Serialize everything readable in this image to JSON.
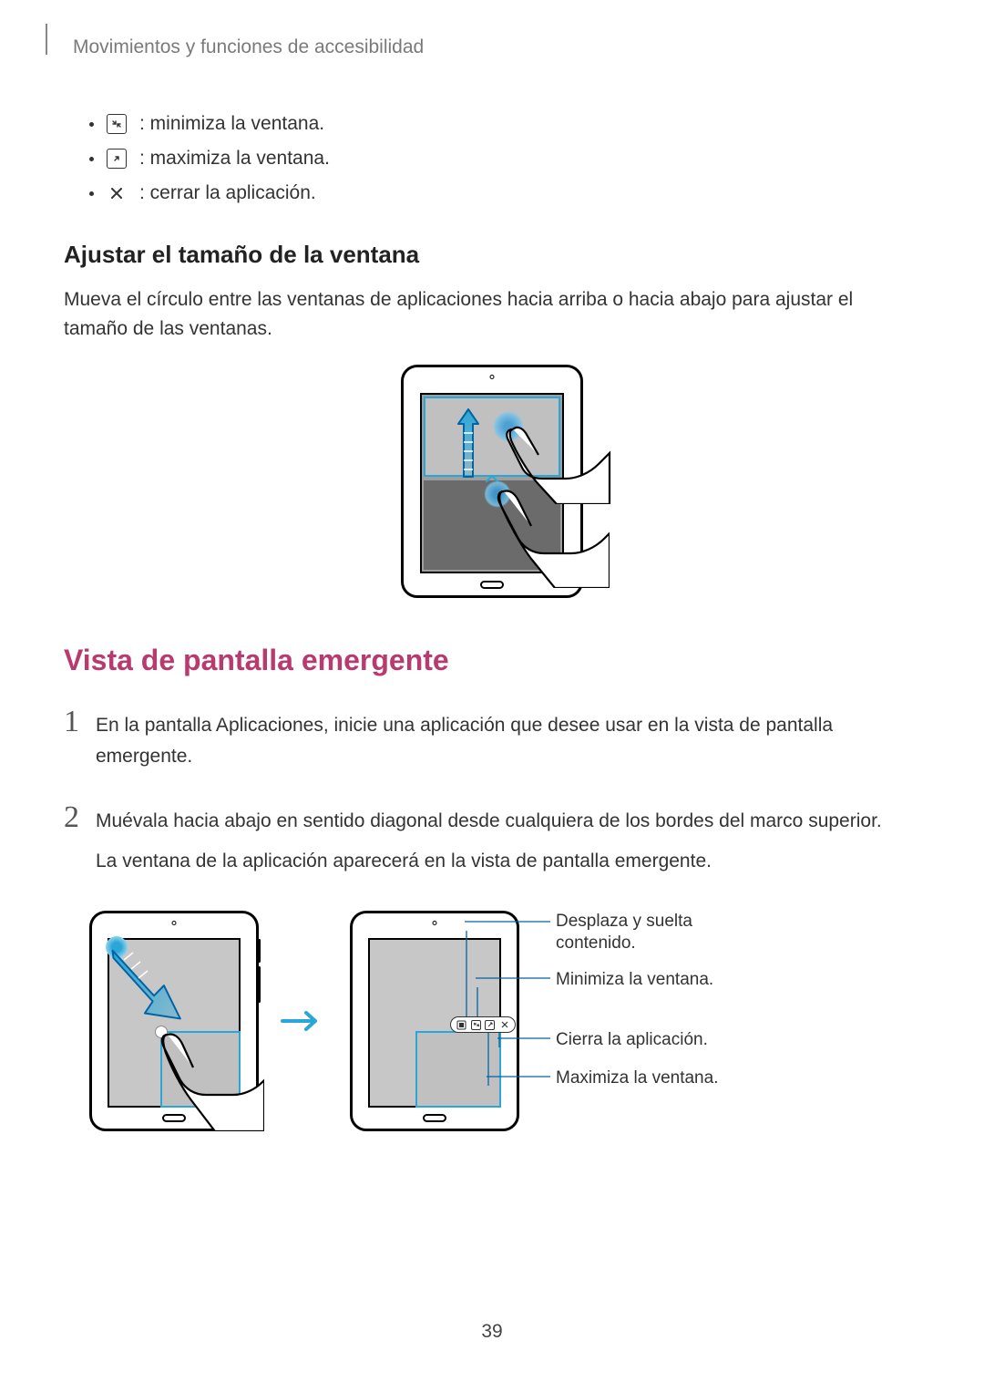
{
  "header": "Movimientos y funciones de accesibilidad",
  "bullets": {
    "minimize": ": minimiza la ventana.",
    "maximize": ": maximiza la ventana.",
    "close": ": cerrar la aplicación."
  },
  "subheading": "Ajustar el tamaño de la ventana",
  "resize_text": "Mueva el círculo entre las ventanas de aplicaciones hacia arriba o hacia abajo para ajustar el tamaño de las ventanas.",
  "main_heading": "Vista de pantalla emergente",
  "steps": [
    {
      "num": "1",
      "text": "En la pantalla Aplicaciones, inicie una aplicación que desee usar en la vista de pantalla emergente."
    },
    {
      "num": "2",
      "text": "Muévala hacia abajo en sentido diagonal desde cualquiera de los bordes del marco superior.",
      "text2": "La ventana de la aplicación aparecerá en la vista de pantalla emergente."
    }
  ],
  "callouts": {
    "drag": "Desplaza y suelta contenido.",
    "minimize": "Minimiza la ventana.",
    "close": "Cierra la aplicación.",
    "maximize": "Maximiza la ventana."
  },
  "page_number": "39"
}
